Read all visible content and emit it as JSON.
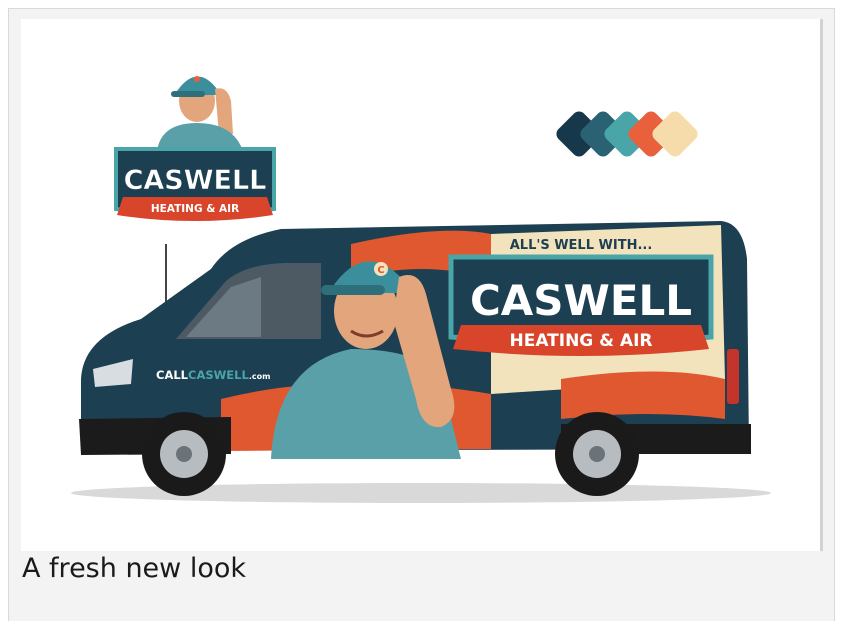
{
  "caption": "A fresh new look",
  "image": {
    "logo": {
      "brand": "CASWELL",
      "tagline": "HEATING & AIR"
    },
    "van": {
      "slogan": "ALL'S WELL WITH...",
      "brand": "CASWELL",
      "tagline": "HEATING & AIR",
      "website_prefix": "CALL",
      "website_main": "CASWELL",
      "website_suffix": ".com",
      "cap_letter": "C"
    },
    "palette": [
      "#17384a",
      "#2a6274",
      "#4aa5a8",
      "#e8603c",
      "#f6dcab"
    ]
  },
  "colors": {
    "navy": "#1c3f52",
    "teal": "#3f8a94",
    "orange": "#e0582f",
    "cream": "#f3e3bd",
    "red_banner": "#d8452a"
  }
}
